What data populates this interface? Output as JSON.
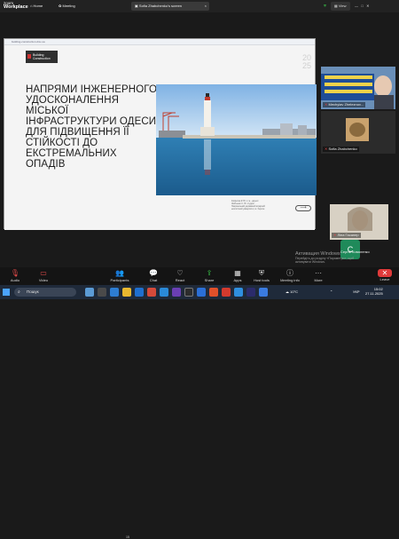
{
  "zoom": {
    "brand_top": "zoom",
    "brand_bottom": "Workplace",
    "tabs": [
      {
        "label": "Home"
      },
      {
        "label": "Meeting"
      },
      {
        "label": "Sofia Zhabchenko's screen"
      }
    ],
    "view_label": "View",
    "security_shield": "shield-icon"
  },
  "slide": {
    "url": "building-construction.dnu.ua",
    "logo_line1": "Building",
    "logo_line2": "Construction",
    "year_line1": "20",
    "year_line2": "25",
    "title": "НАПРЯМИ ІНЖЕНЕРНОГО УДОСКОНАЛЕННЯ МІСЬКОЇ ІНФРАСТРУКТУРИ ОДЕСИ ДЛЯ ПІДВИЩЕННЯ ЇЇ СТІЙКОСТІ ДО ЕКСТРЕМАЛЬНИХ ОПАДІВ",
    "caption_lines": [
      "Коврегіна Є.Ю. к.т.н., доцент",
      "Жабченко С. Ю. студент",
      "Національний державний аграрний",
      "екологічний університет, м. Херсон"
    ]
  },
  "participants": [
    {
      "name": "Mechylav Zheleznov..."
    },
    {
      "name": "Sofia Zhabchenko"
    },
    {
      "name": "Ліна Гасанер"
    },
    {
      "name": "Сергій Коваленко"
    }
  ],
  "windows_watermark": {
    "line1": "Активация Windows",
    "line2": "Перейдіть до розділу «Параметри», щоб",
    "line3": "активувати Windows."
  },
  "toolbar": [
    {
      "label": "Audio",
      "icon": "mic-off-icon"
    },
    {
      "label": "Video",
      "icon": "video-off-icon"
    },
    {
      "label": "Participants",
      "count": "15",
      "icon": "participants-icon"
    },
    {
      "label": "Chat",
      "icon": "chat-icon"
    },
    {
      "label": "React",
      "icon": "heart-icon"
    },
    {
      "label": "Share",
      "icon": "share-icon"
    },
    {
      "label": "Apps",
      "icon": "apps-icon"
    },
    {
      "label": "Host tools",
      "icon": "shield-icon"
    },
    {
      "label": "Meeting info",
      "icon": "info-icon"
    },
    {
      "label": "More",
      "icon": "more-icon"
    },
    {
      "label": "Leave",
      "icon": "close-icon"
    }
  ],
  "taskbar": {
    "search_placeholder": "Пошук",
    "weather": "10°C",
    "lang": "УКР",
    "time": "15:02",
    "date": "27.11.2025"
  }
}
